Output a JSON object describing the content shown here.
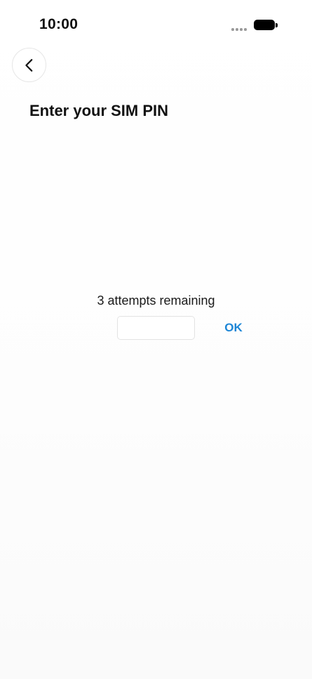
{
  "status_bar": {
    "time": "10:00"
  },
  "header": {
    "back_icon": "chevron-left-icon",
    "title": "Enter your SIM PIN"
  },
  "pin_form": {
    "attempts_text": "3 attempts remaining",
    "pin_value": "",
    "ok_label": "OK"
  },
  "colors": {
    "accent": "#1d86d6",
    "text": "#111111",
    "input_border": "#e3e3e3"
  }
}
